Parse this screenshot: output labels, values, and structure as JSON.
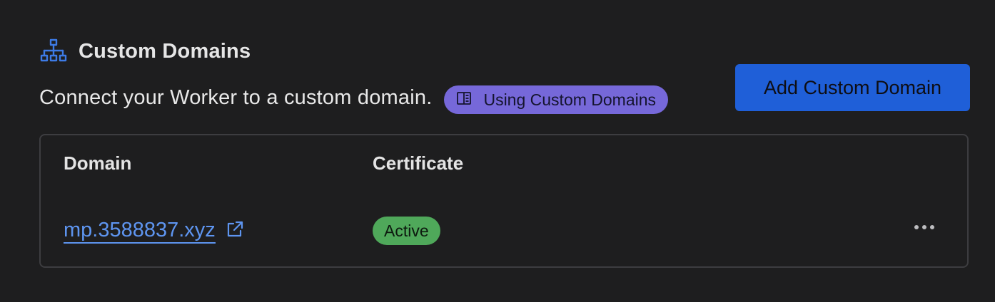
{
  "section": {
    "icon": "sitemap-icon",
    "title": "Custom Domains",
    "description": "Connect your Worker to a custom domain.",
    "docs_link": {
      "icon": "book-icon",
      "label": "Using Custom Domains"
    },
    "add_button_label": "Add Custom Domain"
  },
  "table": {
    "columns": [
      "Domain",
      "Certificate"
    ],
    "rows": [
      {
        "domain": "mp.3588837.xyz",
        "domain_icon": "external-link-icon",
        "certificate": "Active",
        "actions_icon": "more-horizontal-icon"
      }
    ]
  },
  "colors": {
    "background": "#1e1e1f",
    "accent_blue": "#1f5fd8",
    "link_blue": "#5e95f0",
    "docs_pill": "#7668d9",
    "status_active": "#4fa85a",
    "border": "#3d3d40"
  }
}
